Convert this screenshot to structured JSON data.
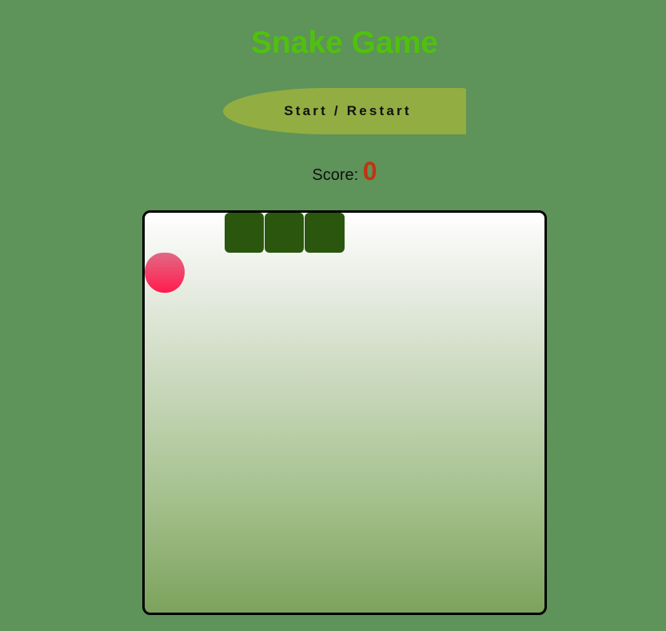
{
  "title": "Snake Game",
  "controls": {
    "start_label": "Start / Restart"
  },
  "score": {
    "label": "Score:",
    "value": "0"
  },
  "game": {
    "grid_columns": 10,
    "grid_rows": 10,
    "snake": [
      {
        "col": 2,
        "row": 0
      },
      {
        "col": 3,
        "row": 0
      },
      {
        "col": 4,
        "row": 0
      }
    ],
    "food": {
      "col": 0,
      "row": 1
    }
  },
  "colors": {
    "background": "#5e9359",
    "title": "#4fc10d",
    "button": "#92ad42",
    "score_value": "#c23312",
    "snake": "#2a560e",
    "food": "#f53a64"
  }
}
